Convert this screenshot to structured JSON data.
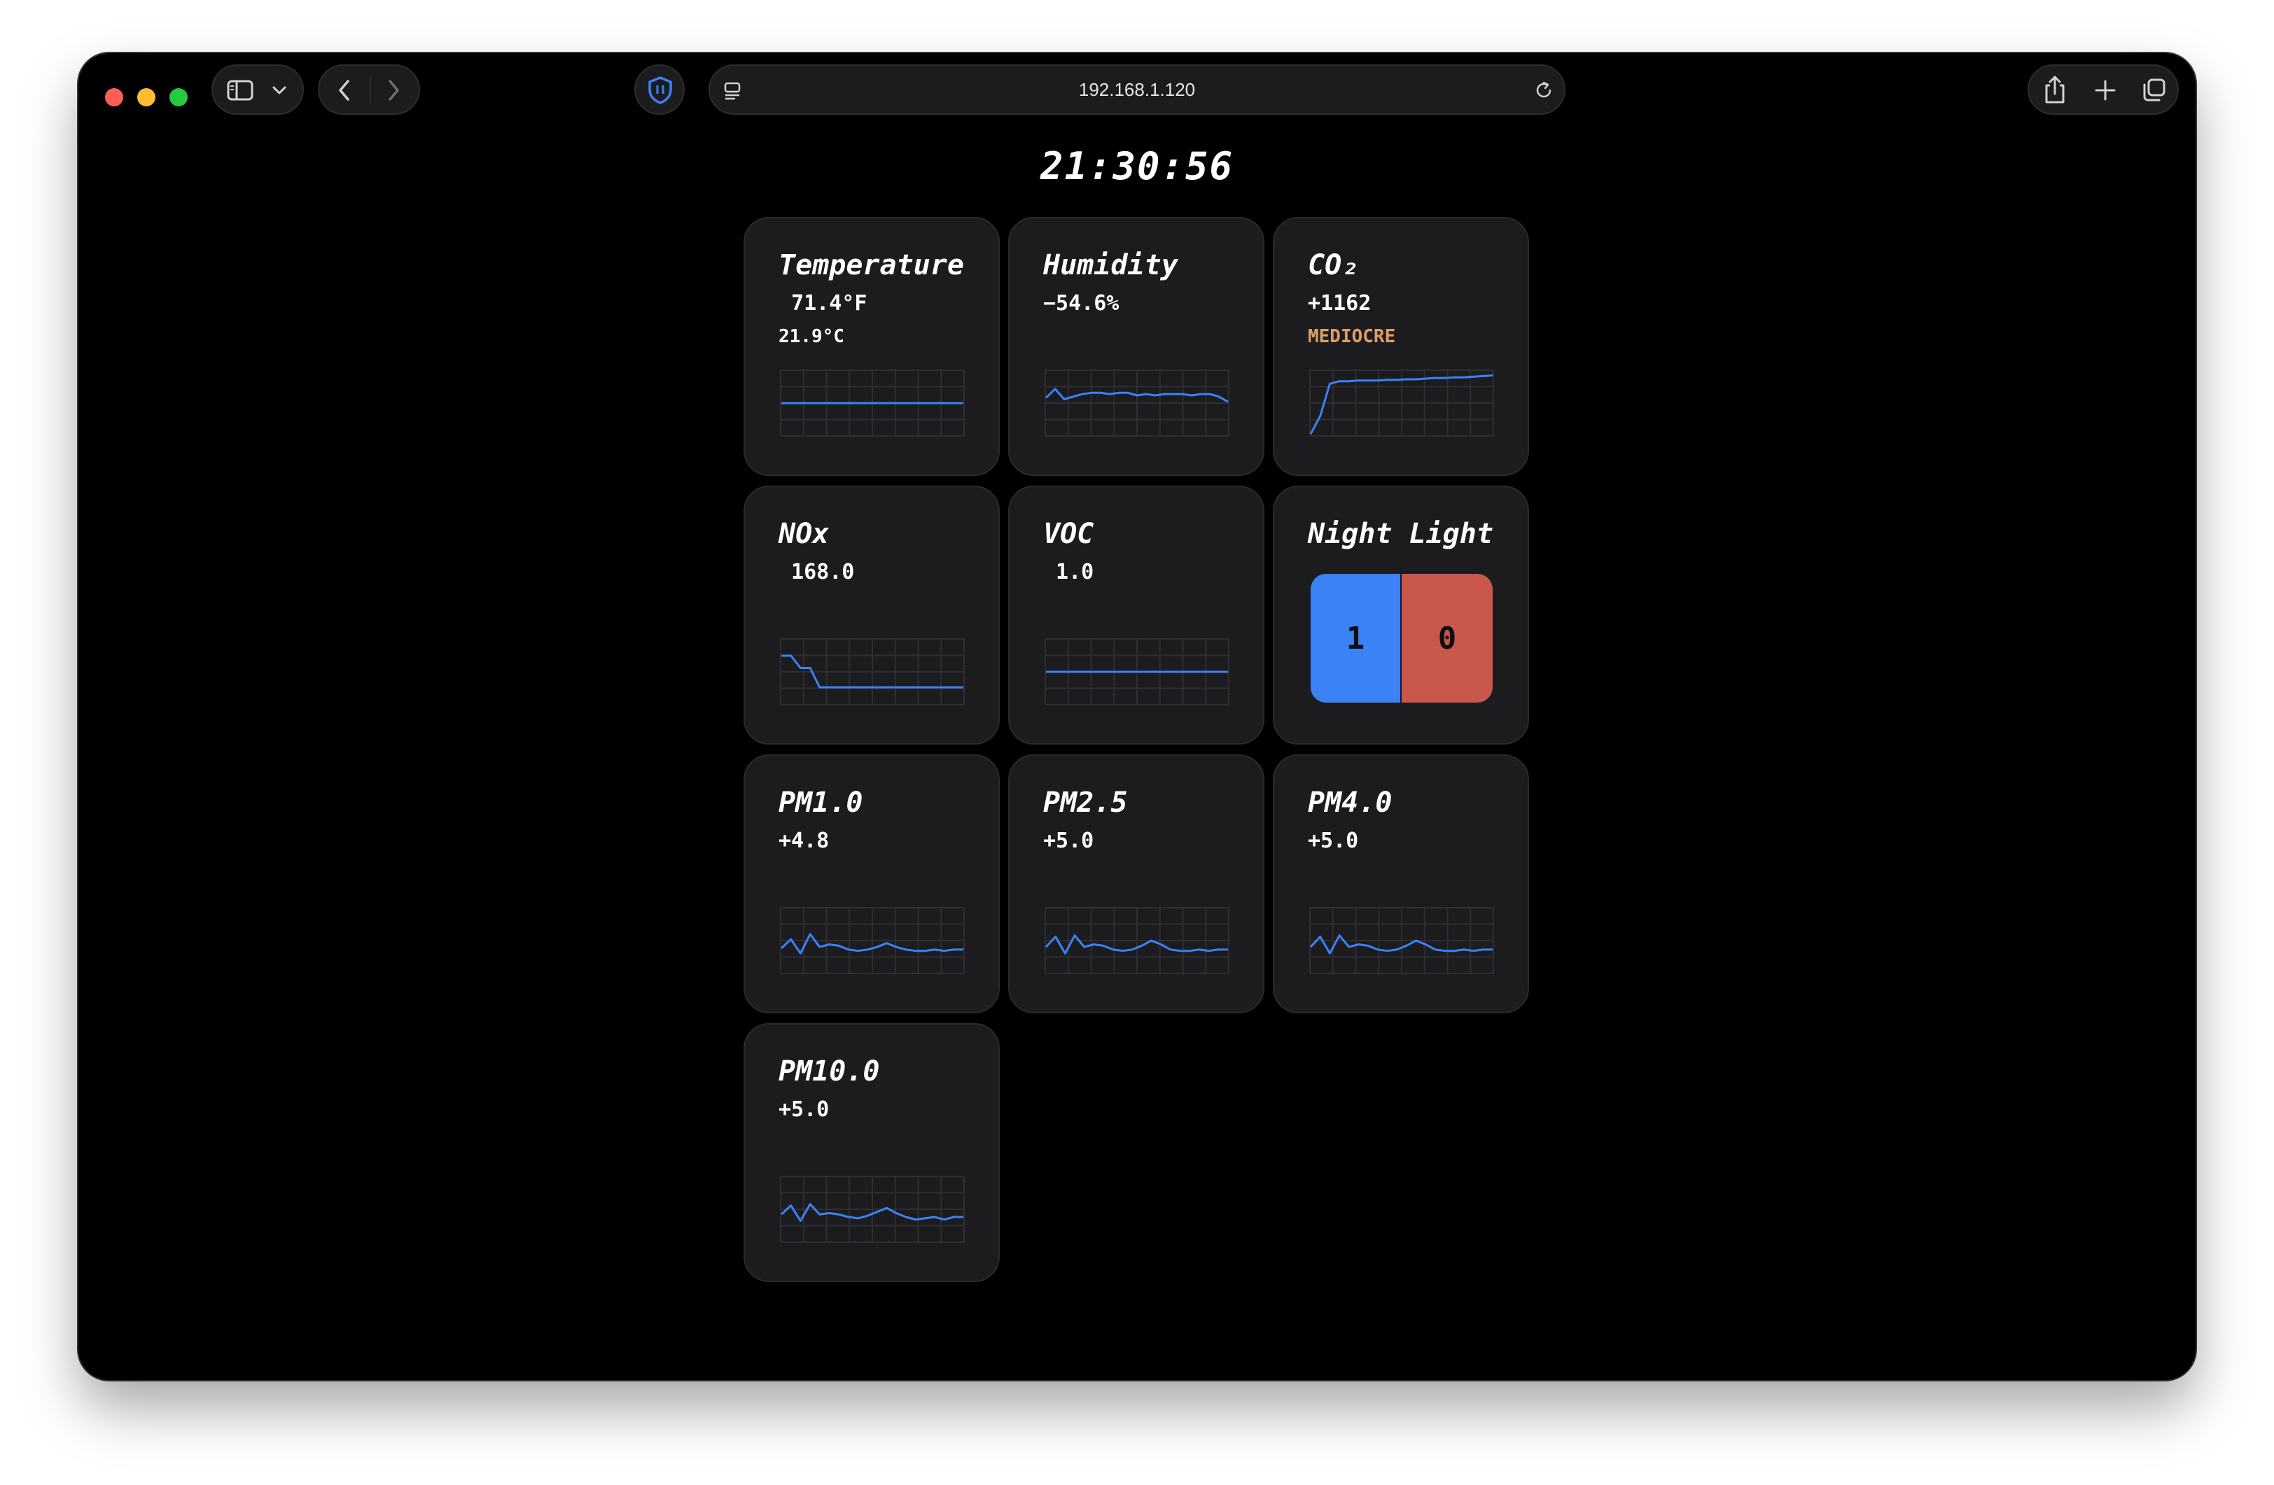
{
  "browser": {
    "url": "192.168.1.120",
    "icons": [
      "sidebar-icon",
      "chevron-down-icon",
      "back-icon",
      "forward-icon",
      "shield-icon",
      "page-icon",
      "reload-icon",
      "share-icon",
      "plus-icon",
      "tabs-icon"
    ]
  },
  "clock": "21:30:56",
  "cards": [
    {
      "title": "Temperature",
      "value": " 71.4°F",
      "sub": "21.9°C",
      "series": [
        50,
        50,
        50,
        50,
        50,
        50,
        50,
        50,
        50,
        50,
        50,
        50,
        50,
        50,
        50,
        50,
        50,
        50,
        50,
        50
      ]
    },
    {
      "title": "Humidity",
      "value": "−54.6%",
      "series": [
        58,
        72,
        56,
        60,
        64,
        66,
        66,
        64,
        66,
        66,
        62,
        64,
        62,
        64,
        64,
        64,
        62,
        64,
        64,
        60,
        52
      ]
    },
    {
      "title": "CO₂",
      "value": "+1162",
      "sub": "MEDIOCRE",
      "sub_class": "warn",
      "series": [
        2,
        30,
        80,
        84,
        84,
        85,
        85,
        85,
        86,
        86,
        87,
        87,
        88,
        89,
        89,
        90,
        90,
        91,
        92,
        93
      ]
    },
    {
      "title": "NOx",
      "value": " 168.0",
      "series": [
        75,
        75,
        56,
        56,
        26,
        26,
        26,
        26,
        26,
        26,
        26,
        26,
        26,
        26,
        26,
        26,
        26,
        26,
        26,
        26
      ]
    },
    {
      "title": "VOC",
      "value": " 1.0",
      "series": [
        50,
        50,
        50,
        50,
        50,
        50,
        50,
        50,
        50,
        50,
        50,
        50,
        50,
        50,
        50,
        50,
        50,
        50,
        50,
        50
      ]
    },
    {
      "title": "Night Light",
      "toggle": {
        "on": "1",
        "off": "0"
      }
    },
    {
      "title": "PM1.0",
      "value": "+4.8",
      "series": [
        38,
        52,
        30,
        60,
        40,
        44,
        42,
        36,
        34,
        36,
        40,
        46,
        40,
        36,
        34,
        34,
        36,
        34,
        36,
        36
      ]
    },
    {
      "title": "PM2.5",
      "value": "+5.0",
      "series": [
        40,
        56,
        30,
        58,
        40,
        44,
        42,
        36,
        34,
        36,
        42,
        50,
        44,
        36,
        34,
        34,
        36,
        34,
        36,
        36
      ]
    },
    {
      "title": "PM4.0",
      "value": "+5.0",
      "series": [
        40,
        56,
        30,
        58,
        40,
        44,
        42,
        36,
        34,
        36,
        42,
        50,
        44,
        36,
        34,
        34,
        36,
        34,
        36,
        36
      ]
    },
    {
      "title": "PM10.0",
      "value": "+5.0",
      "series": [
        42,
        56,
        32,
        58,
        42,
        44,
        42,
        38,
        36,
        40,
        46,
        52,
        44,
        38,
        34,
        36,
        38,
        34,
        38,
        38
      ]
    }
  ],
  "colors": {
    "line": "#3b82f6",
    "grid": "#2e2e33",
    "toggle_on": "#3b82f6",
    "toggle_off": "#c9574b",
    "warn": "#d9a066"
  }
}
